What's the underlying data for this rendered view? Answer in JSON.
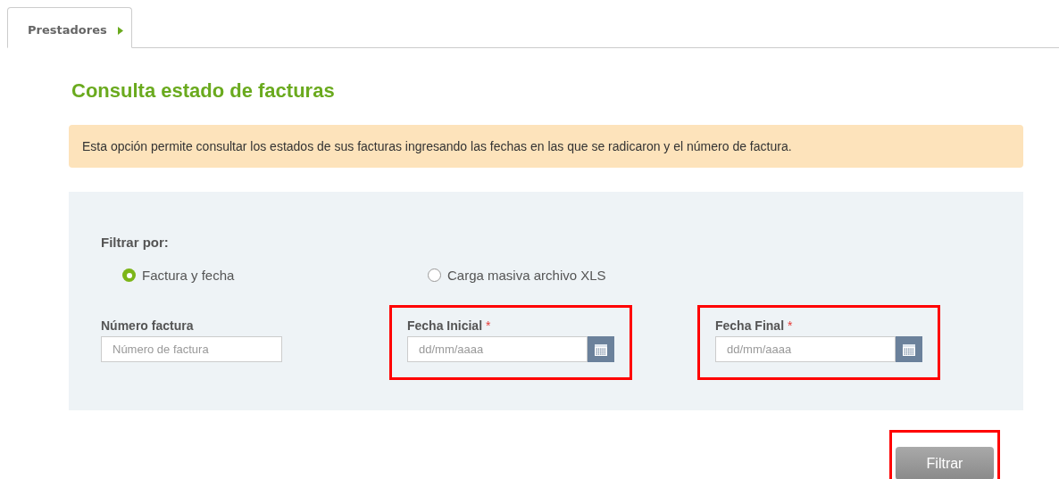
{
  "tabs": [
    {
      "label": "Prestadores",
      "selected": true
    }
  ],
  "title": "Consulta estado de facturas",
  "notice": "Esta opción permite consultar los estados de sus facturas ingresando las fechas en las que se radicaron y el número de factura.",
  "filter": {
    "label": "Filtrar por:",
    "options": [
      {
        "label": "Factura y fecha",
        "selected": true
      },
      {
        "label": "Carga masiva archivo XLS",
        "selected": false
      }
    ],
    "fields": [
      {
        "kind": "text",
        "label": "Número factura",
        "placeholder": "Número de factura",
        "highlighted": false
      },
      {
        "kind": "date",
        "label": "Fecha Inicial",
        "required_mark": "*",
        "placeholder": "dd/mm/aaaa",
        "highlighted": true
      },
      {
        "kind": "date",
        "label": "Fecha Final",
        "required_mark": "*",
        "placeholder": "dd/mm/aaaa",
        "highlighted": true
      }
    ]
  },
  "submit": {
    "label": "Filtrar",
    "highlighted": true
  }
}
